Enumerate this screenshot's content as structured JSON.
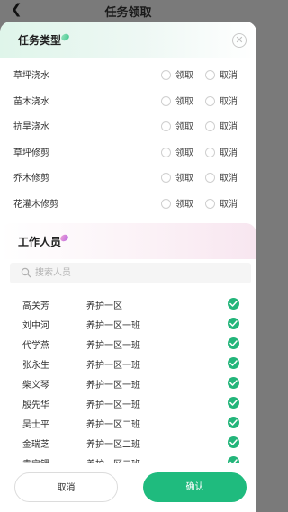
{
  "header": {
    "back_icon": "chevron-left-icon",
    "title": "任务领取"
  },
  "task_section": {
    "title": "任务类型",
    "close_icon": "close-icon",
    "tasks": [
      {
        "name": "草坪浇水",
        "options": [
          "领取",
          "取消"
        ]
      },
      {
        "name": "苗木浇水",
        "options": [
          "领取",
          "取消"
        ]
      },
      {
        "name": "抗旱浇水",
        "options": [
          "领取",
          "取消"
        ]
      },
      {
        "name": "草坪修剪",
        "options": [
          "领取",
          "取消"
        ]
      },
      {
        "name": "乔木修剪",
        "options": [
          "领取",
          "取消"
        ]
      },
      {
        "name": "花灌木修剪",
        "options": [
          "领取",
          "取消"
        ]
      }
    ]
  },
  "staff_section": {
    "title": "工作人员",
    "search_placeholder": "搜索人员",
    "staff": [
      {
        "name": "高关芳",
        "group": "养护一区",
        "checked": true
      },
      {
        "name": "刘中河",
        "group": "养护一区一班",
        "checked": true
      },
      {
        "name": "代学燕",
        "group": "养护一区一班",
        "checked": true
      },
      {
        "name": "张永生",
        "group": "养护一区一班",
        "checked": true
      },
      {
        "name": "柴义琴",
        "group": "养护一区一班",
        "checked": true
      },
      {
        "name": "殷先华",
        "group": "养护一区一班",
        "checked": true
      },
      {
        "name": "吴士平",
        "group": "养护一区二班",
        "checked": true
      },
      {
        "name": "金瑞芝",
        "group": "养护一区二班",
        "checked": true
      },
      {
        "name": "袁宝锂",
        "group": "养护一区二班",
        "checked": true
      }
    ]
  },
  "footer": {
    "cancel_label": "取消",
    "confirm_label": "确认"
  },
  "colors": {
    "accent": "#1fbb7e",
    "check": "#23b57a"
  }
}
